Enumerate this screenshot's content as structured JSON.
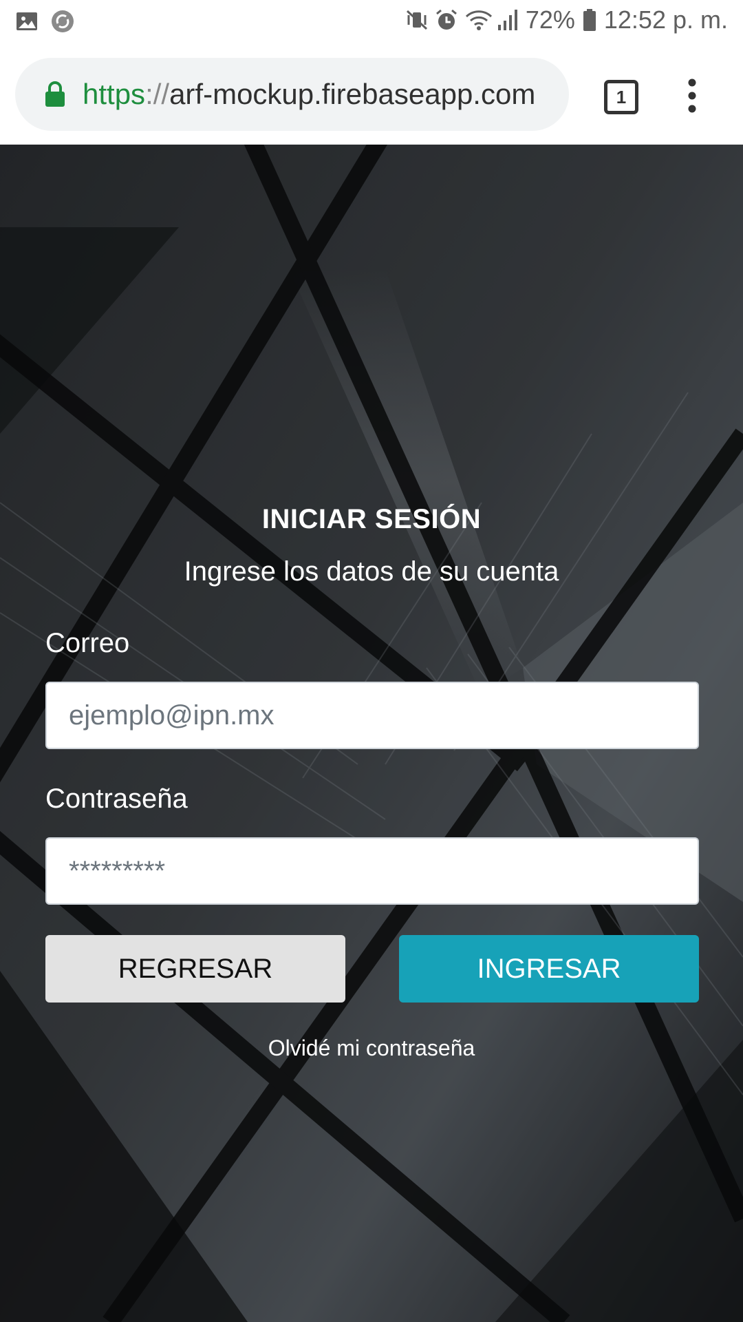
{
  "status_bar": {
    "icons_left": [
      "image-icon",
      "sync-icon"
    ],
    "icons_right": [
      "mute-vibrate-icon",
      "alarm-icon",
      "wifi-icon",
      "signal-icon",
      "battery-icon"
    ],
    "battery": "72%",
    "time": "12:52 p. m."
  },
  "browser": {
    "url_scheme": "https",
    "url_separator": "://",
    "url_host": "arf-mockup.firebaseapp.com",
    "tab_count": "1",
    "secure_color": "#1e8e3e"
  },
  "login": {
    "title": "INICIAR SESIÓN",
    "subtitle": "Ingrese los datos de su cuenta",
    "email_label": "Correo",
    "email_placeholder": "ejemplo@ipn.mx",
    "password_label": "Contraseña",
    "password_placeholder": "*********",
    "back_button": "REGRESAR",
    "submit_button": "INGRESAR",
    "forgot_link": "Olvidé mi contraseña",
    "accent_color": "#17a2b8"
  }
}
